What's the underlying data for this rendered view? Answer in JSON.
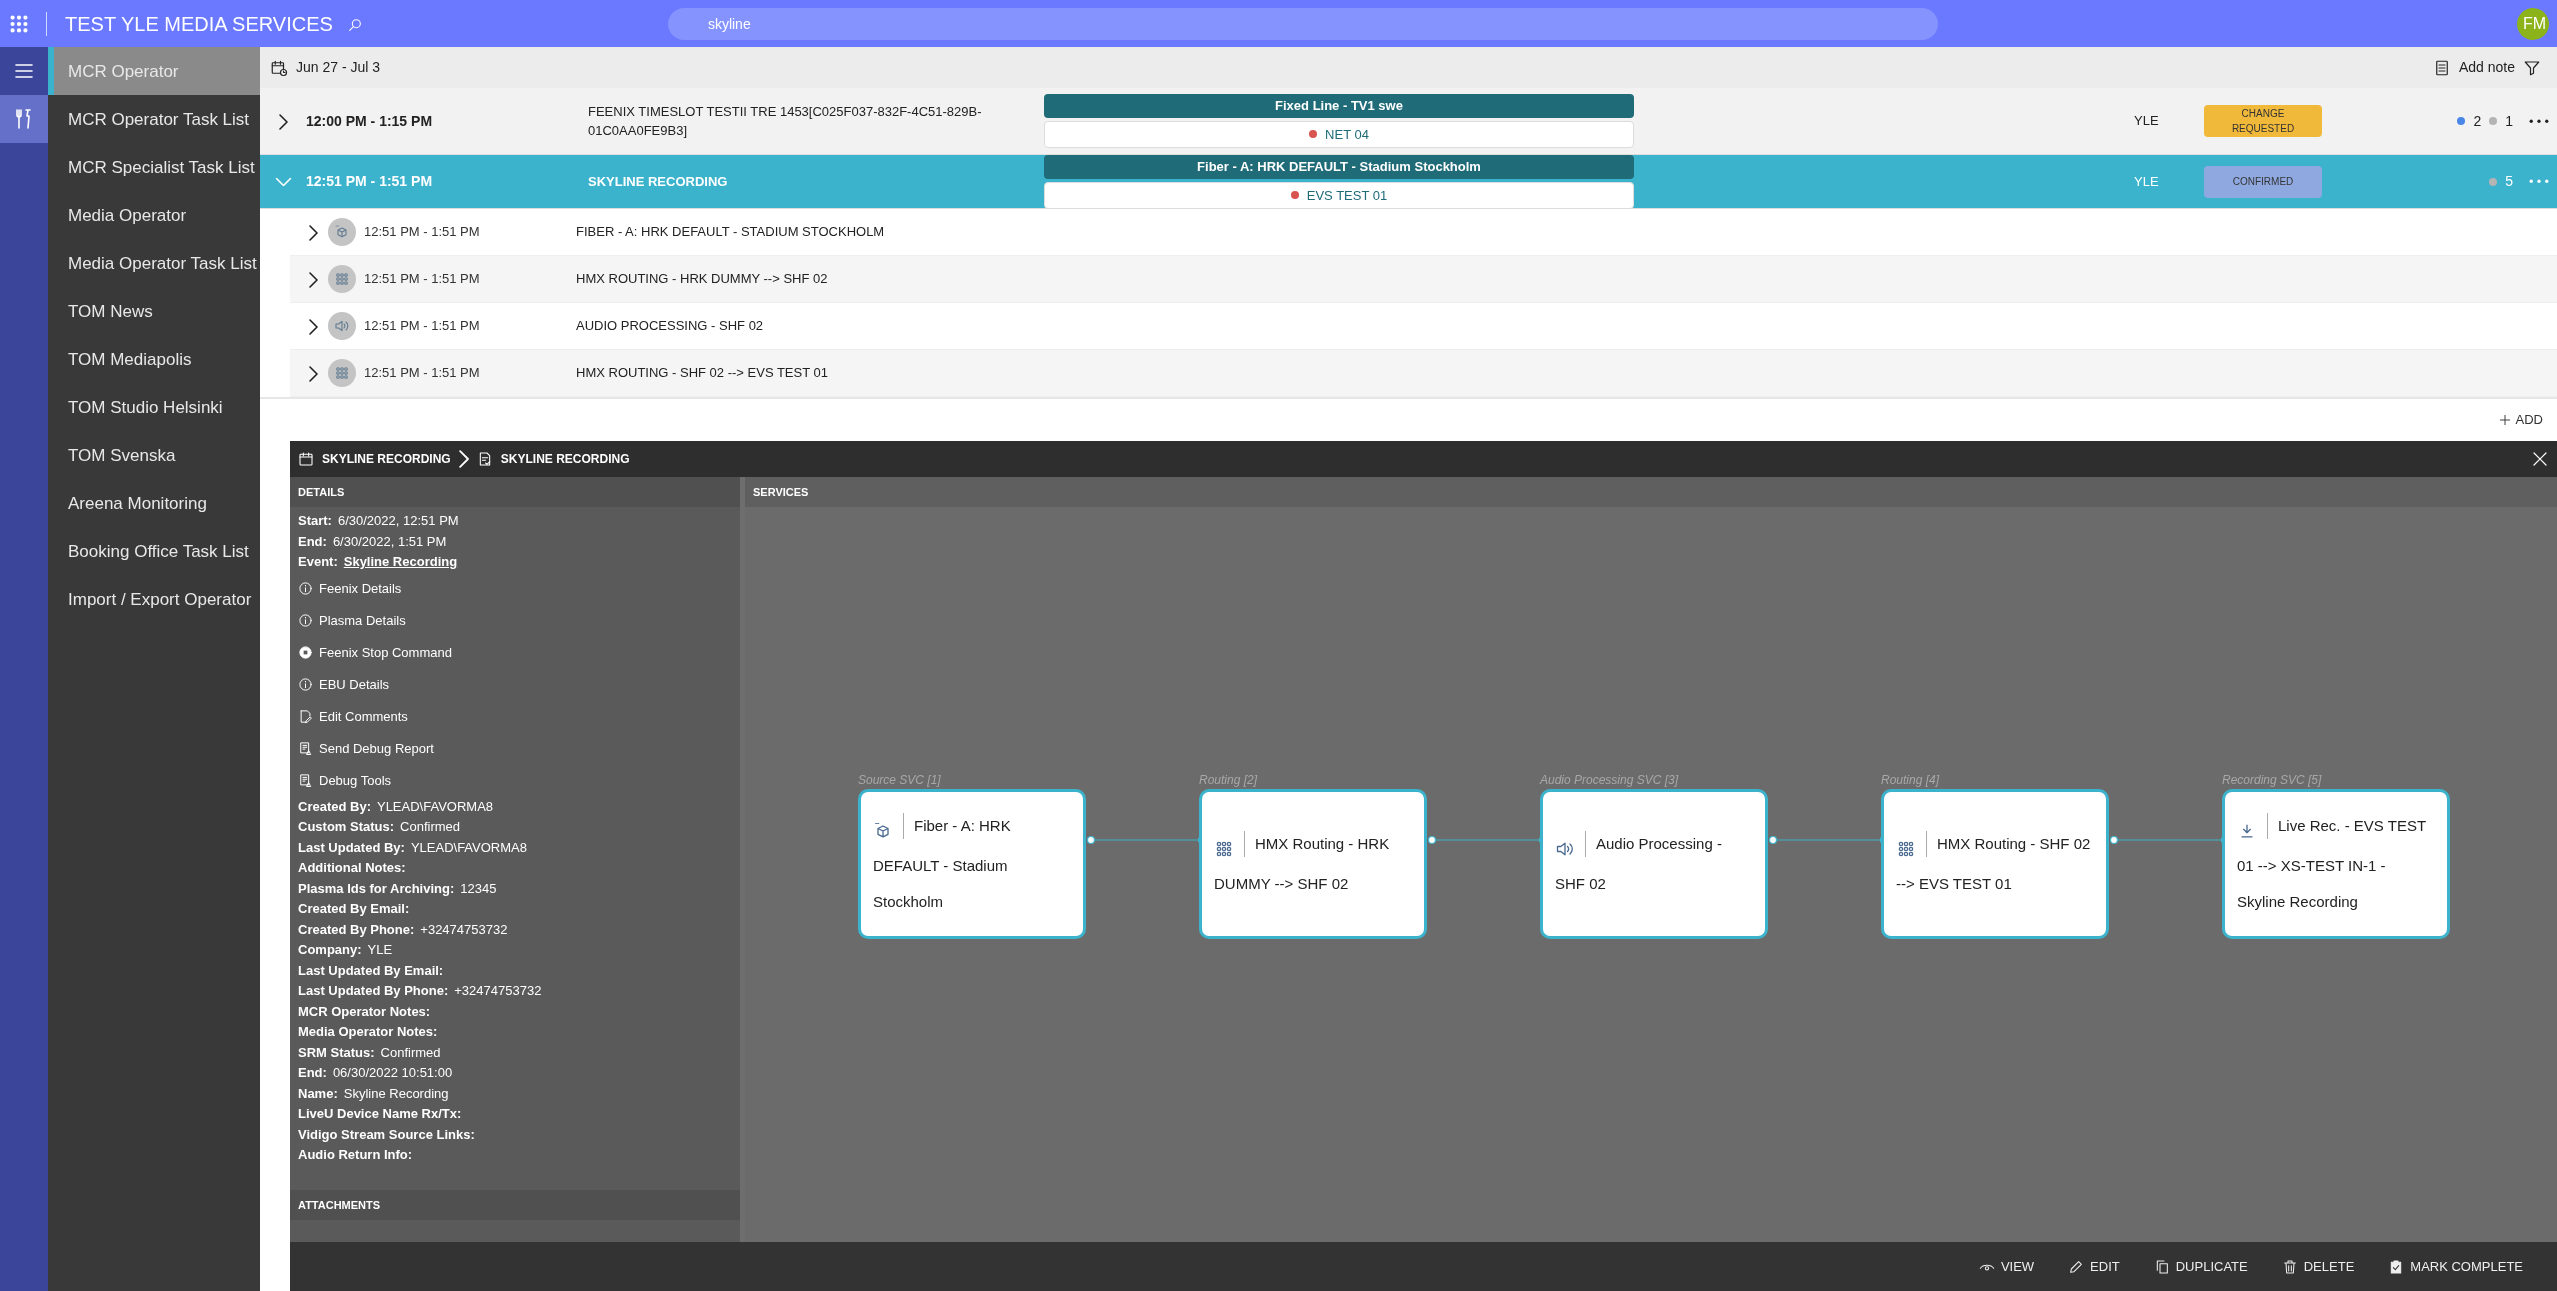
{
  "app": {
    "title": "TEST YLE MEDIA SERVICES",
    "search": "skyline",
    "avatar": "FM"
  },
  "rail": [
    {
      "kind": "menu",
      "selected": false
    },
    {
      "kind": "tools",
      "selected": true
    }
  ],
  "sidebar": {
    "items": [
      {
        "label": "MCR Operator",
        "selected": true
      },
      {
        "label": "MCR Operator Task List",
        "selected": false
      },
      {
        "label": "MCR Specialist Task List",
        "selected": false
      },
      {
        "label": "Media Operator",
        "selected": false
      },
      {
        "label": "Media Operator Task List",
        "selected": false
      },
      {
        "label": "TOM News",
        "selected": false
      },
      {
        "label": "TOM Mediapolis",
        "selected": false
      },
      {
        "label": "TOM Studio Helsinki",
        "selected": false
      },
      {
        "label": "TOM Svenska",
        "selected": false
      },
      {
        "label": "Areena Monitoring",
        "selected": false
      },
      {
        "label": "Booking Office Task List",
        "selected": false
      },
      {
        "label": "Import / Export Operator",
        "selected": false
      }
    ]
  },
  "toolbar": {
    "date_range": "Jun 27 - Jul 3",
    "add_note": "Add note"
  },
  "table": {
    "rows": [
      {
        "time": "12:00 PM - 1:15 PM",
        "title": "FEENIX TIMESLOT TESTII TRE 1453[C025F037-832F-4C51-829B-01C0AA0FE9B3]",
        "expanded": false,
        "selected": false,
        "service": "Fixed Line - TV1 swe",
        "resource": {
          "label": "NET 04",
          "color": "#d9534f"
        },
        "company": "YLE",
        "status": {
          "label": "CHANGE REQUESTED",
          "kind": "change_requested"
        },
        "counts": [
          {
            "value": "2",
            "color": "#4a86e8"
          },
          {
            "value": "1",
            "color": "#b4b4b4"
          }
        ],
        "children": []
      },
      {
        "time": "12:51 PM - 1:51 PM",
        "title": "SKYLINE RECORDING",
        "expanded": true,
        "selected": true,
        "service": "Fiber - A: HRK DEFAULT - Stadium Stockholm",
        "resource": {
          "label": "EVS TEST 01",
          "color": "#d9534f"
        },
        "company": "YLE",
        "status": {
          "label": "CONFIRMED",
          "kind": "confirmed"
        },
        "counts": [
          {
            "value": "5",
            "color": "#b4b4b4"
          }
        ],
        "children": [
          {
            "kind": "source",
            "expanded": false,
            "time": "12:51 PM - 1:51 PM",
            "title": "FIBER - A: HRK DEFAULT - STADIUM STOCKHOLM"
          },
          {
            "kind": "routing",
            "expanded": false,
            "time": "12:51 PM - 1:51 PM",
            "title": "HMX ROUTING - HRK DUMMY --> SHF 02"
          },
          {
            "kind": "audio",
            "expanded": false,
            "time": "12:51 PM - 1:51 PM",
            "title": "AUDIO PROCESSING - SHF 02"
          },
          {
            "kind": "routing",
            "expanded": false,
            "time": "12:51 PM - 1:51 PM",
            "title": "HMX ROUTING - SHF 02 --> EVS TEST 01"
          }
        ]
      }
    ]
  },
  "add_button": "ADD",
  "panel": {
    "breadcrumb": [
      {
        "kind": "event",
        "label": "SKYLINE RECORDING"
      },
      {
        "kind": "order",
        "label": "SKYLINE RECORDING"
      }
    ],
    "details_title": "DETAILS",
    "details": [
      {
        "kind": "field",
        "label": "Start:",
        "value": "6/30/2022, 12:51 PM"
      },
      {
        "kind": "field",
        "label": "End:",
        "value": "6/30/2022, 1:51 PM"
      },
      {
        "kind": "link",
        "label": "Event:",
        "value": "Skyline Recording"
      },
      {
        "kind": "info",
        "label": "Feenix Details"
      },
      {
        "kind": "info",
        "label": "Plasma Details"
      },
      {
        "kind": "stop",
        "label": "Feenix Stop Command"
      },
      {
        "kind": "info",
        "label": "EBU Details"
      },
      {
        "kind": "edit",
        "label": "Edit Comments"
      },
      {
        "kind": "report",
        "label": "Send Debug Report"
      },
      {
        "kind": "report",
        "label": "Debug Tools"
      },
      {
        "kind": "field",
        "label": "Created By:",
        "value": "YLEAD\\FAVORMA8"
      },
      {
        "kind": "field",
        "label": "Custom Status:",
        "value": "Confirmed"
      },
      {
        "kind": "field",
        "label": "Last Updated By:",
        "value": "YLEAD\\FAVORMA8"
      },
      {
        "kind": "field",
        "label": "Additional Notes:"
      },
      {
        "kind": "field",
        "label": "Plasma Ids for Archiving:",
        "value": "12345"
      },
      {
        "kind": "field",
        "label": "Created By Email:"
      },
      {
        "kind": "field",
        "label": "Created By Phone:",
        "value": "+32474753732"
      },
      {
        "kind": "field",
        "label": "Company:",
        "value": "YLE"
      },
      {
        "kind": "field",
        "label": "Last Updated By Email:"
      },
      {
        "kind": "field",
        "label": "Last Updated By Phone:",
        "value": "+32474753732"
      },
      {
        "kind": "field",
        "label": "MCR Operator Notes:"
      },
      {
        "kind": "field",
        "label": "Media Operator Notes:"
      },
      {
        "kind": "field",
        "label": "SRM Status:",
        "value": "Confirmed"
      },
      {
        "kind": "field",
        "label": "End:",
        "value": "06/30/2022 10:51:00"
      },
      {
        "kind": "field",
        "label": "Name:",
        "value": "Skyline Recording"
      },
      {
        "kind": "field",
        "label": "LiveU Device Name Rx/Tx:"
      },
      {
        "kind": "field",
        "label": "Vidigo Stream Source Links:"
      },
      {
        "kind": "field",
        "label": "Audio Return Info:"
      }
    ],
    "attachments_title": "ATTACHMENTS",
    "services_title": "SERVICES",
    "services": [
      {
        "category": "Source SVC [1]",
        "kind": "source",
        "label": "Fiber - A: HRK DEFAULT - Stadium Stockholm"
      },
      {
        "category": "Routing [2]",
        "kind": "routing",
        "label": "HMX Routing - HRK DUMMY --> SHF 02"
      },
      {
        "category": "Audio Processing SVC [3]",
        "kind": "audio",
        "label": "Audio Processing - SHF 02"
      },
      {
        "category": "Routing [4]",
        "kind": "routing",
        "label": "HMX Routing - SHF 02 --> EVS TEST 01"
      },
      {
        "category": "Recording SVC [5]",
        "kind": "recording",
        "label": "Live Rec. - EVS TEST 01 --> XS-TEST IN-1 - Skyline Recording"
      }
    ],
    "actions": [
      {
        "kind": "view",
        "label": "VIEW"
      },
      {
        "kind": "edit",
        "label": "EDIT"
      },
      {
        "kind": "duplicate",
        "label": "DUPLICATE"
      },
      {
        "kind": "delete",
        "label": "DELETE"
      },
      {
        "kind": "complete",
        "label": "MARK COMPLETE"
      }
    ]
  }
}
